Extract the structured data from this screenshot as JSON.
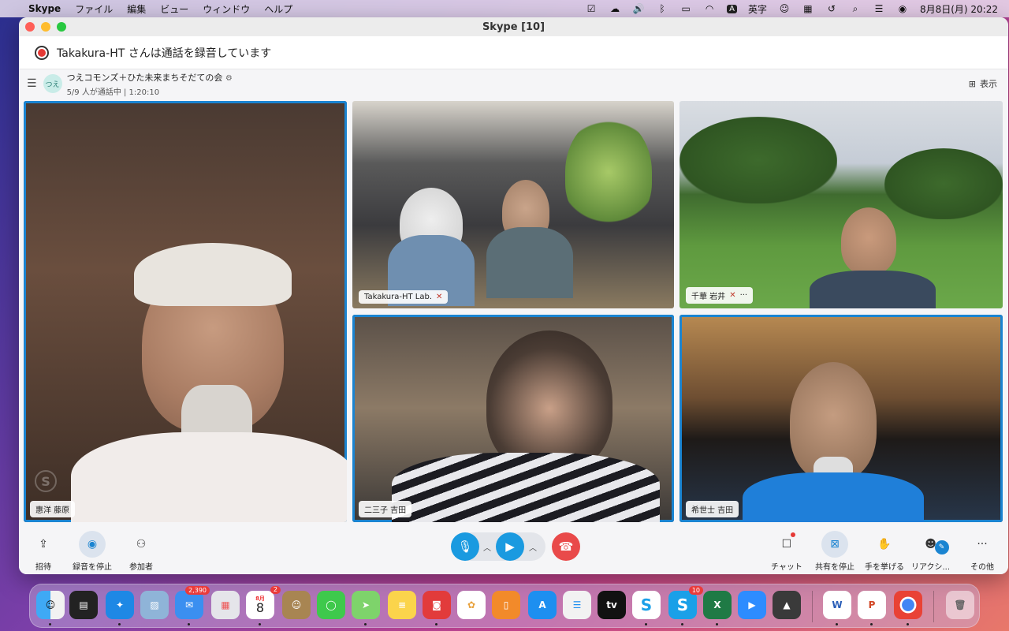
{
  "menubar": {
    "app_name": "Skype",
    "menus": [
      "ファイル",
      "編集",
      "ビュー",
      "ウィンドウ",
      "ヘルプ"
    ],
    "input_mode": "英字",
    "datetime": "8月8日(月)  20:22"
  },
  "window": {
    "title": "Skype [10]"
  },
  "recording_banner": {
    "text": "Takakura-HT さんは通話を録音しています"
  },
  "call": {
    "group_avatar": "つえ",
    "group_name": "つえコモンズ＋ひた未来まちそだての会",
    "status": "5/9 人が通話中 | 1:20:10",
    "view_label": "表示"
  },
  "participants": [
    {
      "name": "惠洋 藤原",
      "speaking": true,
      "muted": false
    },
    {
      "name": "Takakura-HT Lab.",
      "speaking": false,
      "muted": true
    },
    {
      "name": "千華 岩井",
      "speaking": false,
      "muted": true
    },
    {
      "name": "二三子 吉田",
      "speaking": true,
      "muted": false
    },
    {
      "name": "希世士 吉田",
      "speaking": true,
      "muted": false
    }
  ],
  "toolbar": {
    "invite": "招待",
    "stop_recording": "録音を停止",
    "participants": "参加者",
    "chat": "チャット",
    "stop_sharing": "共有を停止",
    "raise_hand": "手を挙げる",
    "reactions": "リアクシ...",
    "more": "その他"
  },
  "dock": {
    "mail_badge": "2,390",
    "calendar_month": "8月",
    "calendar_day": "8",
    "calendar_badge": "2",
    "skype_badge": "10"
  },
  "colors": {
    "accent": "#1a84d1",
    "hangup": "#e94a4a",
    "record": "#e53935"
  }
}
